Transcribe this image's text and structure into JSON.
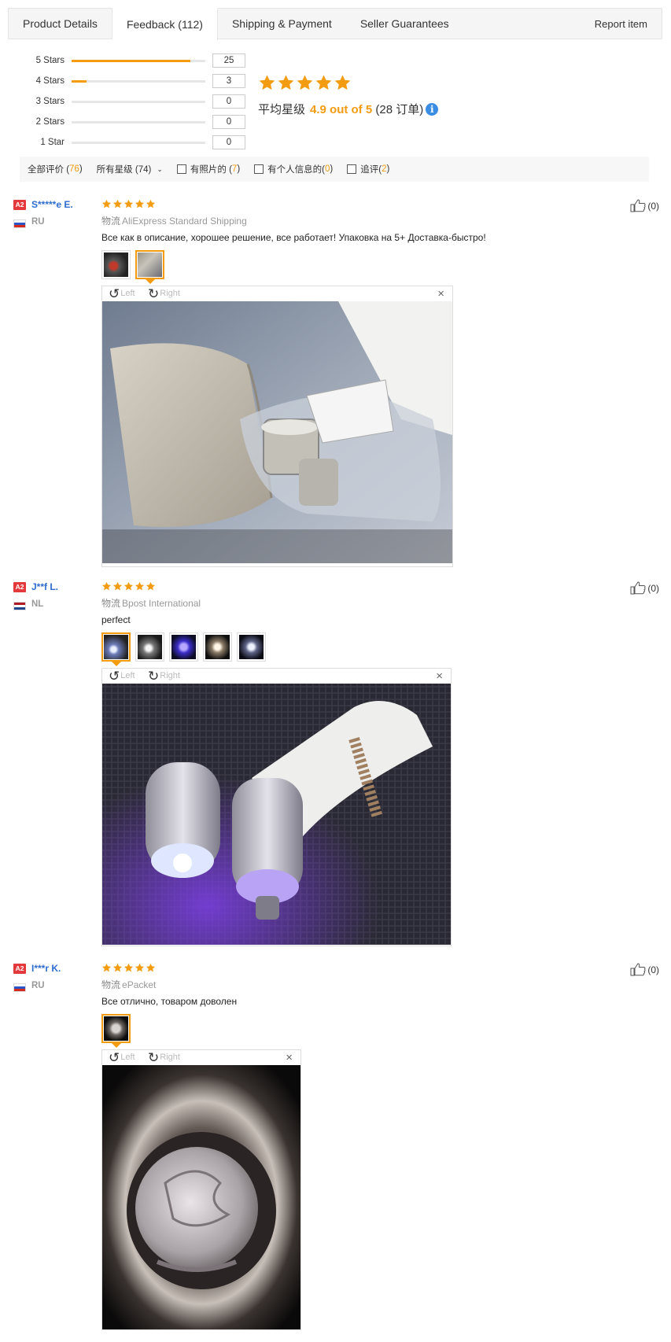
{
  "tabs": [
    {
      "label": "Product Details"
    },
    {
      "label": "Feedback (112)"
    },
    {
      "label": "Shipping & Payment"
    },
    {
      "label": "Seller Guarantees"
    }
  ],
  "report_label": "Report item",
  "histogram": [
    {
      "label": "5 Stars",
      "count": "25",
      "fill_fraction": 0.89
    },
    {
      "label": "4 Stars",
      "count": "3",
      "fill_fraction": 0.11
    },
    {
      "label": "3 Stars",
      "count": "0",
      "fill_fraction": 0
    },
    {
      "label": "2 Stars",
      "count": "0",
      "fill_fraction": 0
    },
    {
      "label": "1 Star",
      "count": "0",
      "fill_fraction": 0
    }
  ],
  "summary": {
    "stars": 5,
    "avg_label": "平均星级",
    "avg_score": "4.9 out of 5",
    "orders": "(28 订单)"
  },
  "filters": {
    "all_label": "全部评价 (",
    "all_count": "76",
    "all_close": ")",
    "stars_label": "所有星级 (74)",
    "photo_label": "有照片的 (",
    "photo_count": "7",
    "photo_close": ")",
    "info_label": "有个人信息的(",
    "info_count": "0",
    "info_close": ")",
    "follow_label": "追评(",
    "follow_count": "2",
    "follow_close": ")"
  },
  "viewer": {
    "left": "Left",
    "right": "Right",
    "close": "×"
  },
  "reviews": [
    {
      "badge": "A2",
      "name": "S*****e E.",
      "country": "RU",
      "flag": "ru",
      "stars": 5,
      "ship_label": "物流",
      "ship_method": "AliExpress Standard Shipping",
      "comment": "Все как в описание, хорошее решение, все работает! Упаковка на 5+ Доставка-быстро!",
      "likes": "(0)"
    },
    {
      "badge": "A2",
      "name": "J**f L.",
      "country": "NL",
      "flag": "nl",
      "stars": 5,
      "ship_label": "物流",
      "ship_method": "Bpost International",
      "comment": "perfect",
      "likes": "(0)"
    },
    {
      "badge": "A2",
      "name": "I***r K.",
      "country": "RU",
      "flag": "ru",
      "stars": 5,
      "ship_label": "物流",
      "ship_method": "ePacket",
      "comment": "Все отлично, товаром доволен",
      "likes": "(0)"
    }
  ],
  "colors": {
    "accent": "#f39c12",
    "link": "#2e6ccf",
    "badge": "#e4393c"
  }
}
